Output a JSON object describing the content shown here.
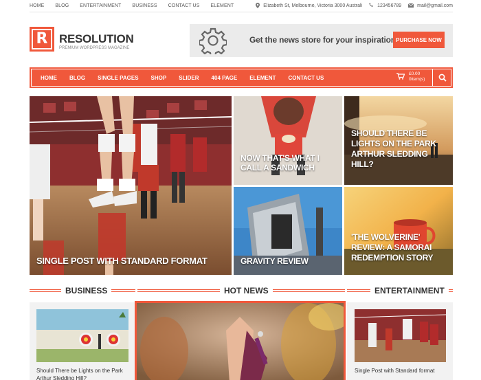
{
  "topbar": {
    "nav": [
      "HOME",
      "BLOG",
      "ENTERTAINMENT",
      "BUSINESS",
      "CONTACT US",
      "ELEMENT"
    ],
    "address": "Elizabeth St, Melbourne, Victoria 3000 Australi",
    "phone": "123456789",
    "email": "mail@gmail.com"
  },
  "header": {
    "logo_letter": "R",
    "brand": "RESOLUTION",
    "tagline": "PREMIUM WORDPRESS MAGAZINE",
    "banner_text": "Get the news store for your inspiration!",
    "banner_button": "PURCHASE NOW"
  },
  "mainnav": {
    "items": [
      "HOME",
      "BLOG",
      "SINGLE PAGES",
      "SHOP",
      "SLIDER",
      "404 PAGE",
      "ELEMENT",
      "CONTACT US"
    ],
    "cart_amount": "£0.00",
    "cart_items": "0item(s)"
  },
  "hero": {
    "main": "SINGLE POST WITH STANDARD FORMAT",
    "sandwich": "NOW THAT'S WHAT I CALL A SANDWICH",
    "park": "SHOULD THERE BE LIGHTS ON THE PARK ARTHUR SLEDDING HILL?",
    "gravity": "GRAVITY REVIEW",
    "wolverine": "'THE WOLVERINE' REVIEW: A SAMORAI REDEMPTION STORY"
  },
  "sections": {
    "business": "BUSINESS",
    "hot_news": "HOT NEWS",
    "entertainment": "ENTERTAINMENT",
    "business_post": "Should There be Lights on the Park Arthur Sledding Hill?",
    "entertainment_post": "Single Post with Standard format"
  },
  "colors": {
    "accent": "#f0583b"
  }
}
